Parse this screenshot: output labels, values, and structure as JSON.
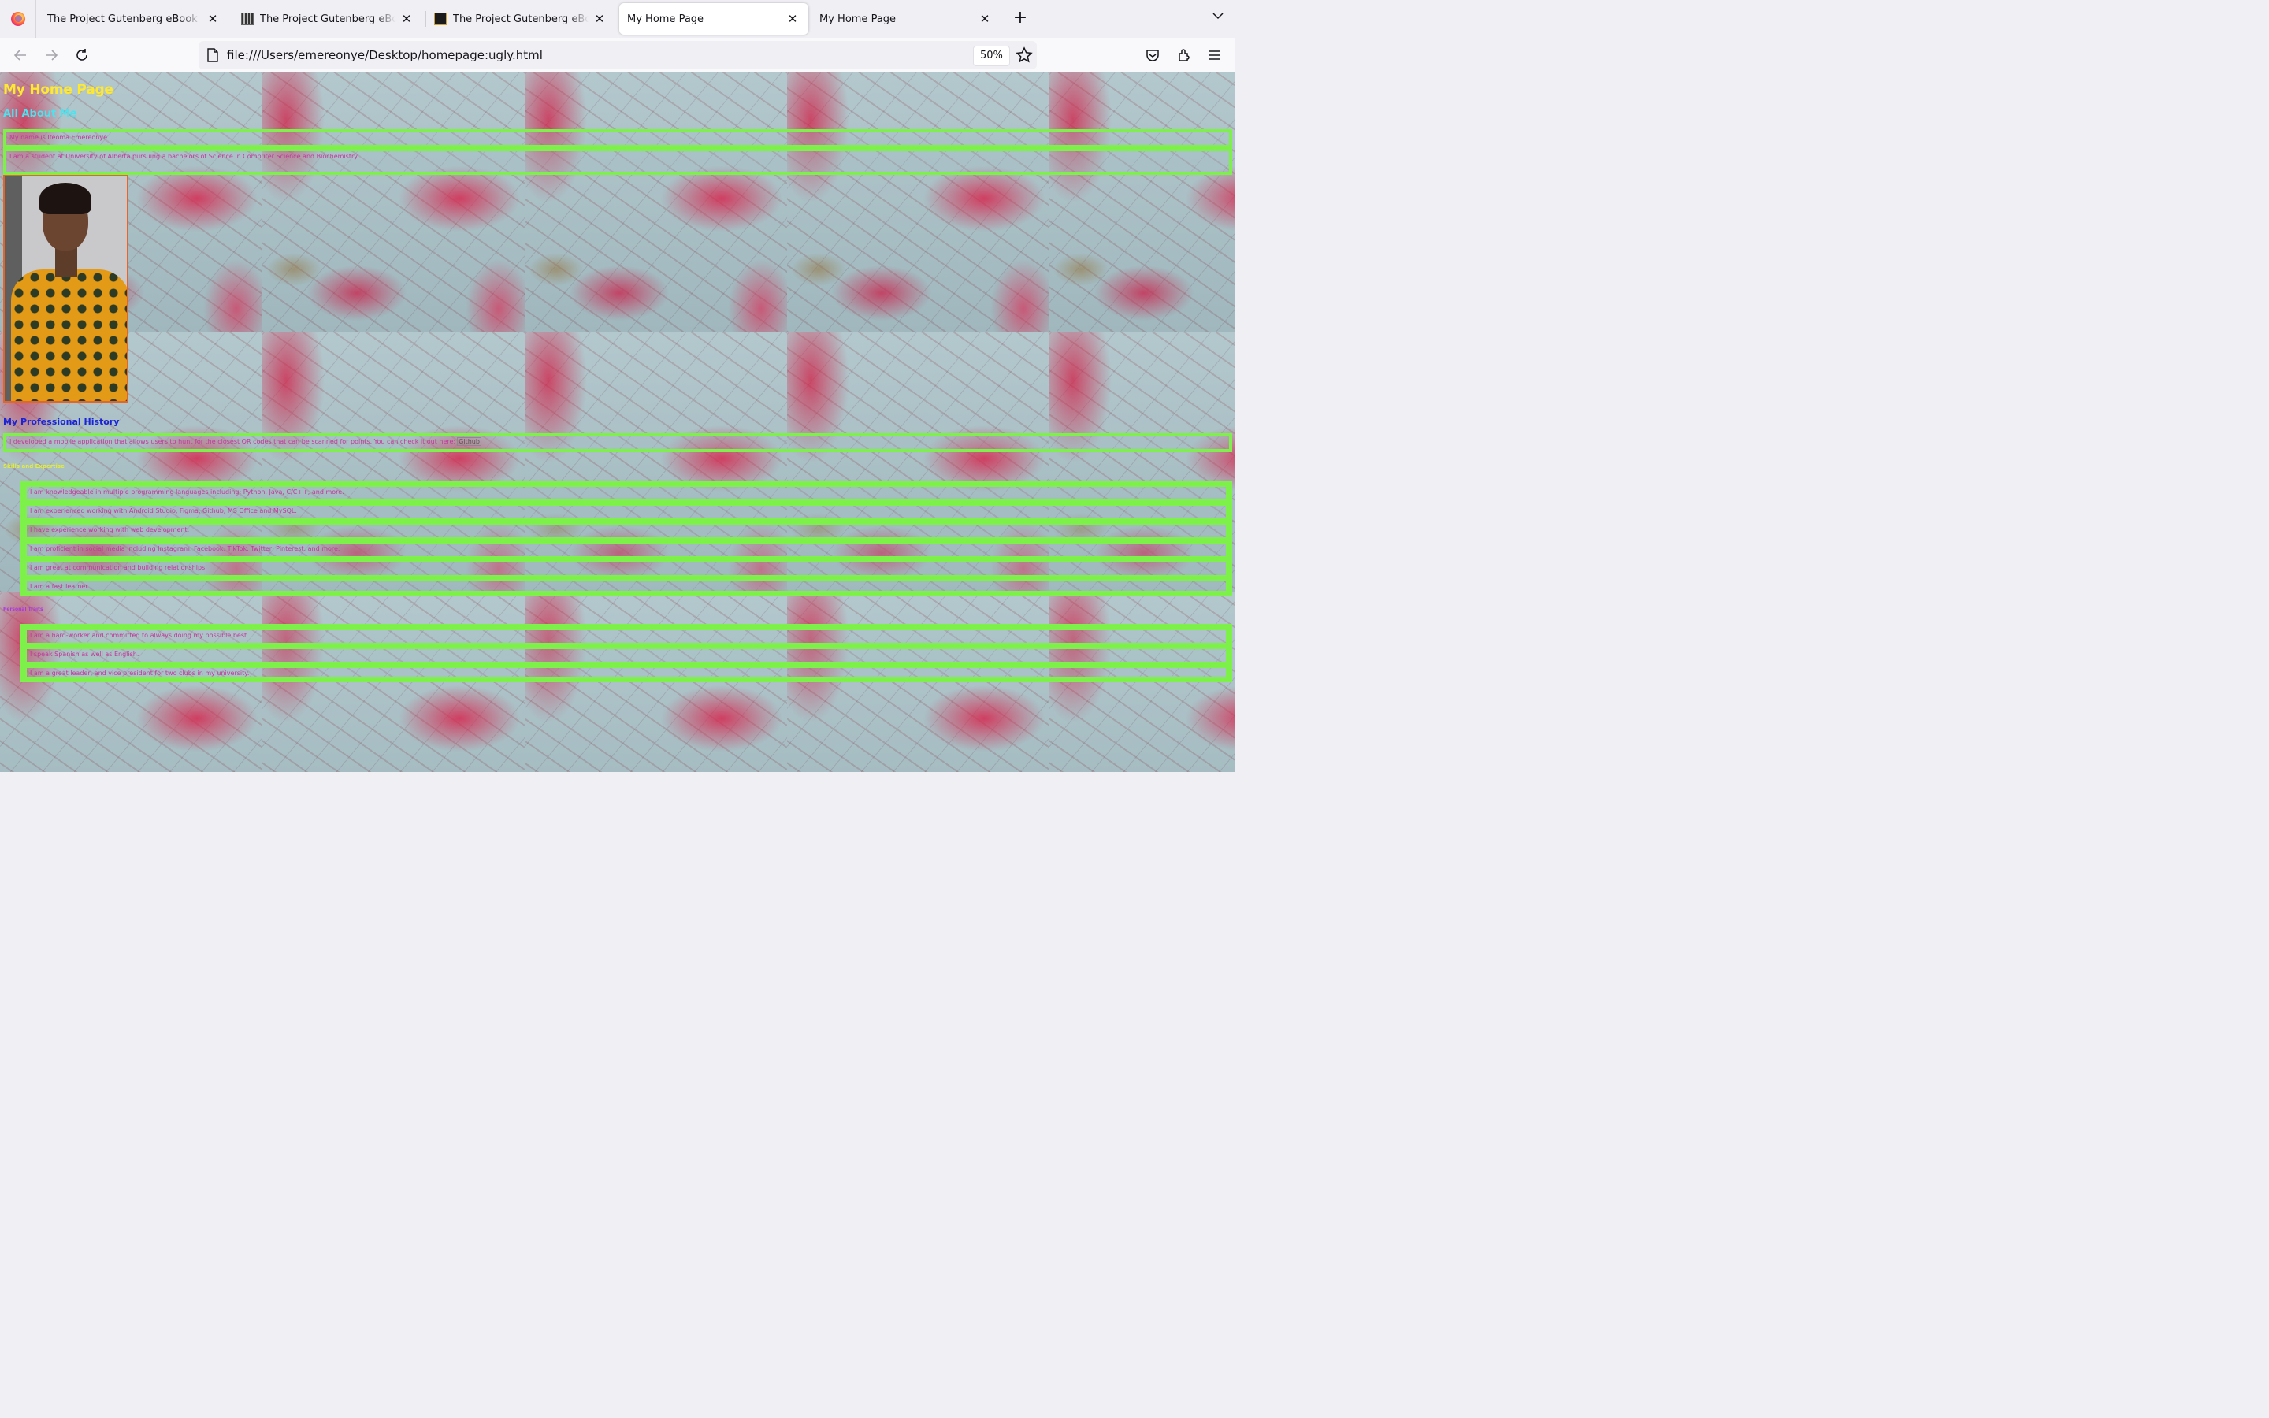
{
  "browser": {
    "tabs": [
      {
        "title": "The Project Gutenberg eBook of The",
        "favicon": "firefox-icon"
      },
      {
        "title": "The Project Gutenberg eBook of",
        "favicon": "book-cover-icon"
      },
      {
        "title": "The Project Gutenberg eBook of",
        "favicon": "book-cover-dark-icon"
      },
      {
        "title": "My Home Page",
        "active": true
      },
      {
        "title": "My Home Page"
      }
    ],
    "url": "file:///Users/emereonye/Desktop/homepage:ugly.html",
    "zoom": "50%"
  },
  "page": {
    "title": "My Home Page",
    "about_heading": "All About Me",
    "about_rows": [
      "My name is Ifeoma Emereonye.",
      "I am a student at University of Alberta pursuing a bachelors of Science in Computer Science and Biochemistry."
    ],
    "portrait_alt": "portrait photo",
    "professional_heading": "My Professional History",
    "professional_text": "I developed a mobile application that allows users to hunt for the closest QR codes that can be scanned for points. You can check it out here:",
    "github_link": "Github",
    "skills_heading": "Skills and Expertise",
    "skills": [
      "I am knowledgeable in multiple programming languages including: Python, Java, C/C++, and more.",
      "I am experienced working with Android Studio, Figma, Github, MS Office and MySQL.",
      "I have experience working with web development.",
      "I am proficient in social media including Instagram, Facebook, TikTok, Twitter, Pinterest, and more.",
      "I am great at communication and building relationships.",
      "I am a fast learner."
    ],
    "personal_heading": "Personal Traits",
    "traits": [
      "I am a hard-worker and committed to always doing my possible best.",
      "I speak Spanish as well as English.",
      "I am a great leader, and vice president for two clubs in my university."
    ]
  },
  "colors": {
    "border_green": "#7df04a",
    "title_yellow": "#ffe830",
    "subtitle_cyan": "#4ae4f0",
    "body_magenta": "#c2399a",
    "history_blue": "#1a24d6"
  }
}
